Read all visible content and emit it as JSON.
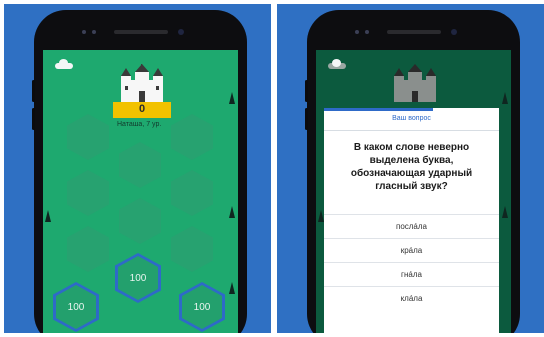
{
  "left_screen": {
    "player_score": "0",
    "player_name": "Наташа, 7 ур.",
    "tiles": [
      {
        "value": "100"
      },
      {
        "value": "100"
      },
      {
        "value": "100"
      }
    ]
  },
  "right_screen": {
    "modal": {
      "title": "Ваш вопрос",
      "question": "В каком слове неверно выделена буква, обозначающая ударный гласный звук?",
      "progress": 0.62
    },
    "answers": [
      "послáла",
      "крáла",
      "гнáла",
      "клáла"
    ]
  },
  "colors": {
    "background": "#2f70c3",
    "game_green": "#1ea96f",
    "game_green_dim": "#0c5a3e",
    "accent_blue": "#2e6ac8",
    "ribbon_gold": "#f2c200"
  }
}
